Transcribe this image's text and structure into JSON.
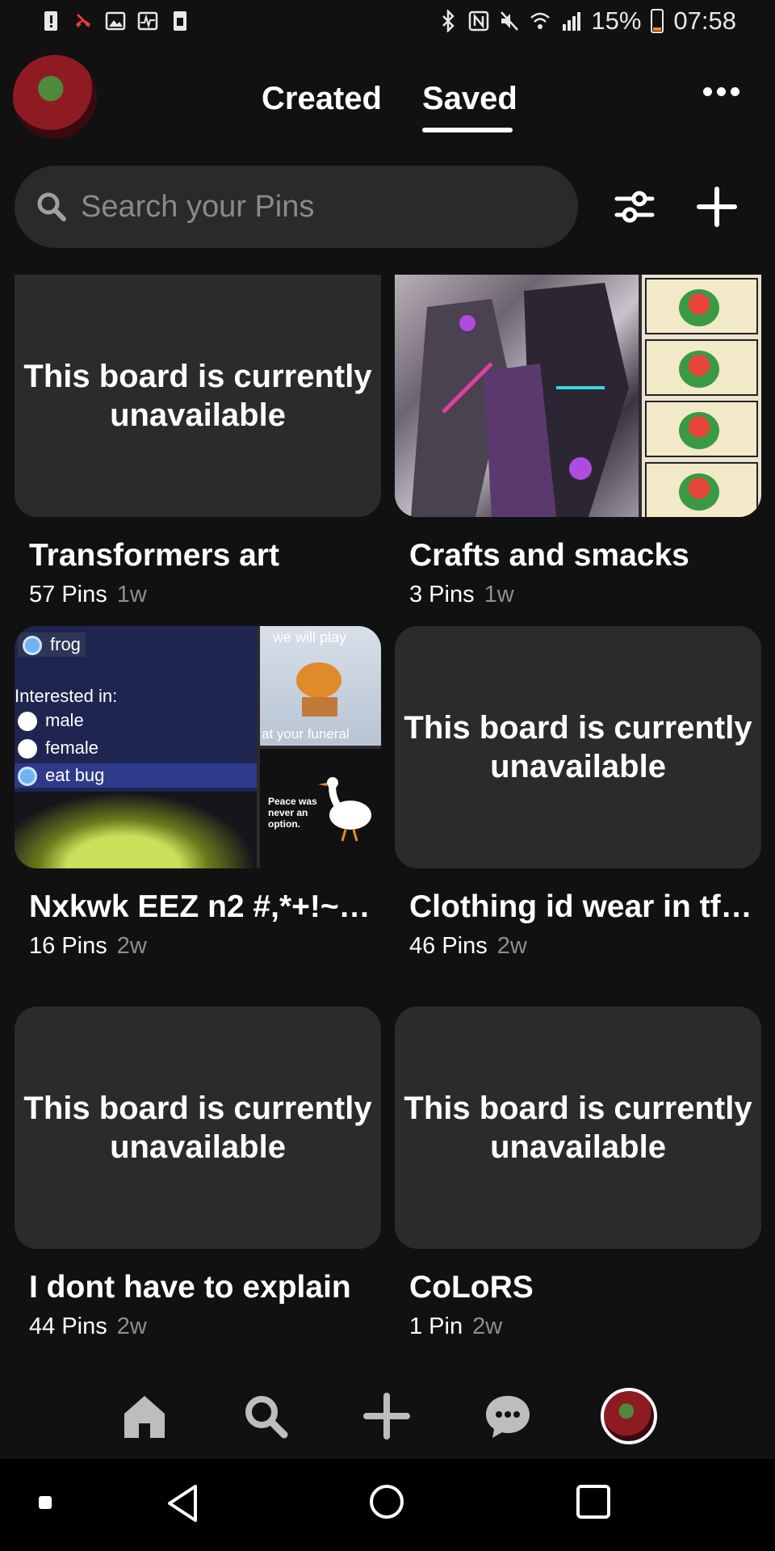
{
  "status_bar": {
    "battery": "15%",
    "time": "07:58",
    "battery_level": 0.15,
    "battery_color": "#ff8a1a"
  },
  "header": {
    "tabs": [
      {
        "label": "Created",
        "active": false
      },
      {
        "label": "Saved",
        "active": true
      }
    ]
  },
  "search": {
    "placeholder": "Search your Pins"
  },
  "boards": [
    {
      "name": "Transformers art",
      "pins": "57 Pins",
      "age": "1w",
      "cover": "This board is currently unavailable"
    },
    {
      "name": "Crafts and smacks",
      "pins": "3 Pins",
      "age": "1w",
      "cover": "image"
    },
    {
      "name": "Nxkwk EEZ n2 #,*+!~…",
      "pins": "16 Pins",
      "age": "2w",
      "cover": "image"
    },
    {
      "name": "Clothing id wear in tf…",
      "pins": "46 Pins",
      "age": "2w",
      "cover": "This board is currently unavailable"
    },
    {
      "name": "I dont have to explain",
      "pins": "44 Pins",
      "age": "2w",
      "cover": "This board is currently unavailable"
    },
    {
      "name": "CoLoRS",
      "pins": "1 Pin",
      "age": "2w",
      "cover": "This board is currently unavailable"
    }
  ],
  "frog_cover": {
    "option_label": "frog",
    "interested": "Interested in:",
    "options": [
      "male",
      "female",
      "eat bug"
    ],
    "meme_top": "we will play",
    "meme_bottom": "at your funeral",
    "goose_text": "Peace was never an option."
  },
  "bottom_nav": [
    "home-icon",
    "search-icon",
    "plus-icon",
    "chat-icon",
    "profile-avatar"
  ],
  "colors": {
    "background": "#111111",
    "surface": "#2b2b2b",
    "search_bg": "#2a2a2a",
    "muted_text": "#8e8e8e"
  }
}
